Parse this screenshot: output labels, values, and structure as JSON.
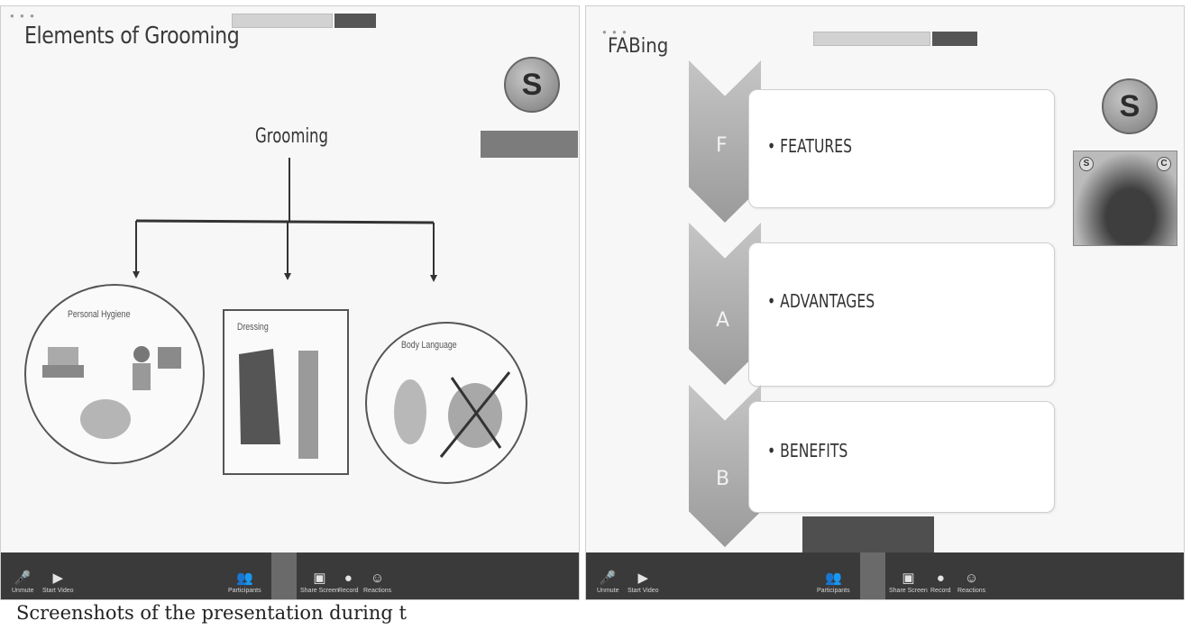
{
  "left_panel": {
    "title": "Elements of Grooming",
    "logo_glyph": "S",
    "diagram": {
      "root": "Grooming",
      "branches": [
        "Personal Hygiene",
        "Dressing",
        "Body Language"
      ]
    }
  },
  "right_panel": {
    "title": "FABing",
    "logo_glyph": "S",
    "video_badges": [
      "S",
      "C"
    ],
    "fab": [
      {
        "letter": "F",
        "text": "• FEATURES"
      },
      {
        "letter": "A",
        "text": "• ADVANTAGES"
      },
      {
        "letter": "B",
        "text": "• BENEFITS"
      }
    ]
  },
  "toolbar": {
    "items": [
      {
        "icon": "microphone-icon",
        "label": "Unmute"
      },
      {
        "icon": "video-icon",
        "label": "Start Video"
      },
      {
        "icon": "participants-icon",
        "label": "Participants"
      },
      {
        "icon": "screen-share-icon",
        "label": "Share Screen"
      },
      {
        "icon": "record-icon",
        "label": "Record"
      },
      {
        "icon": "reactions-icon",
        "label": "Reactions"
      }
    ]
  },
  "caption": "Screenshots of the presentation during t"
}
